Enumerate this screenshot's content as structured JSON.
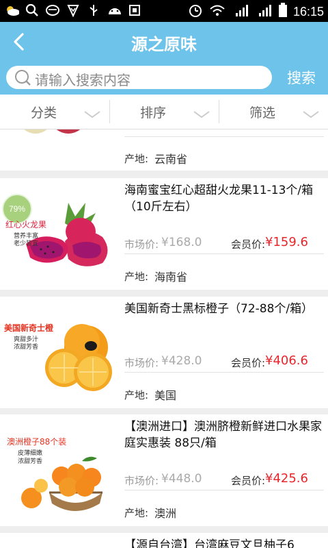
{
  "status_bar": {
    "left_icons": [
      "weather-icon",
      "search-icon",
      "emoji-icon",
      "shield-icon",
      "usb-icon",
      "android-icon",
      "screenshot-icon"
    ],
    "right_icons": [
      "alarm-icon",
      "wifi-icon",
      "signal-1-icon",
      "signal-2-icon",
      "battery-icon"
    ],
    "time": "16:15"
  },
  "header": {
    "title": "源之原味",
    "back_icon": "back-arrow-icon"
  },
  "search": {
    "placeholder": "请输入搜索内容",
    "button_label": "搜索"
  },
  "filters": [
    {
      "label": "分类"
    },
    {
      "label": "排序"
    },
    {
      "label": "筛选"
    }
  ],
  "colors": {
    "accent": "#6dc3ea",
    "price_red": "#e8252b",
    "badge_green": "#a7d17c"
  },
  "products": [
    {
      "name": "",
      "market_price_label": "",
      "market_price": "",
      "member_price_label": "",
      "member_price": "",
      "origin_label": "产地:",
      "origin": "云南省"
    },
    {
      "name": "海南蜜宝红心超甜火龙果11-13个/箱（10斤左右）",
      "image_caption": "红心火龙果",
      "image_sub1": "营养丰富",
      "image_sub2": "老少皆宜",
      "badge": "79%",
      "market_price_label": "市场价:",
      "market_price": "¥168.0",
      "member_price_label": "会员价:",
      "member_price": "¥159.6",
      "origin_label": "产地:",
      "origin": "海南省"
    },
    {
      "name": "美国新奇士黑标橙子（72-88个/箱）",
      "image_caption": "美国新奇士橙",
      "image_sub1": "爽甜多汁",
      "image_sub2": "浓甜芳香",
      "market_price_label": "市场价:",
      "market_price": "¥428.0",
      "member_price_label": "会员价:",
      "member_price": "¥406.6",
      "origin_label": "产地:",
      "origin": "美国"
    },
    {
      "name": "【澳洲进口】澳洲脐橙新鲜进口水果家庭实惠装 88只/箱",
      "image_caption": "澳洲橙子88个装",
      "image_sub1": "皮薄细嫩",
      "image_sub2": "浓甜芳香",
      "market_price_label": "市场价:",
      "market_price": "¥448.0",
      "member_price_label": "会员价:",
      "member_price": "¥425.6",
      "origin_label": "产地:",
      "origin": "澳洲"
    },
    {
      "name": "【源自台湾】台湾麻豆文旦柚子6"
    }
  ]
}
